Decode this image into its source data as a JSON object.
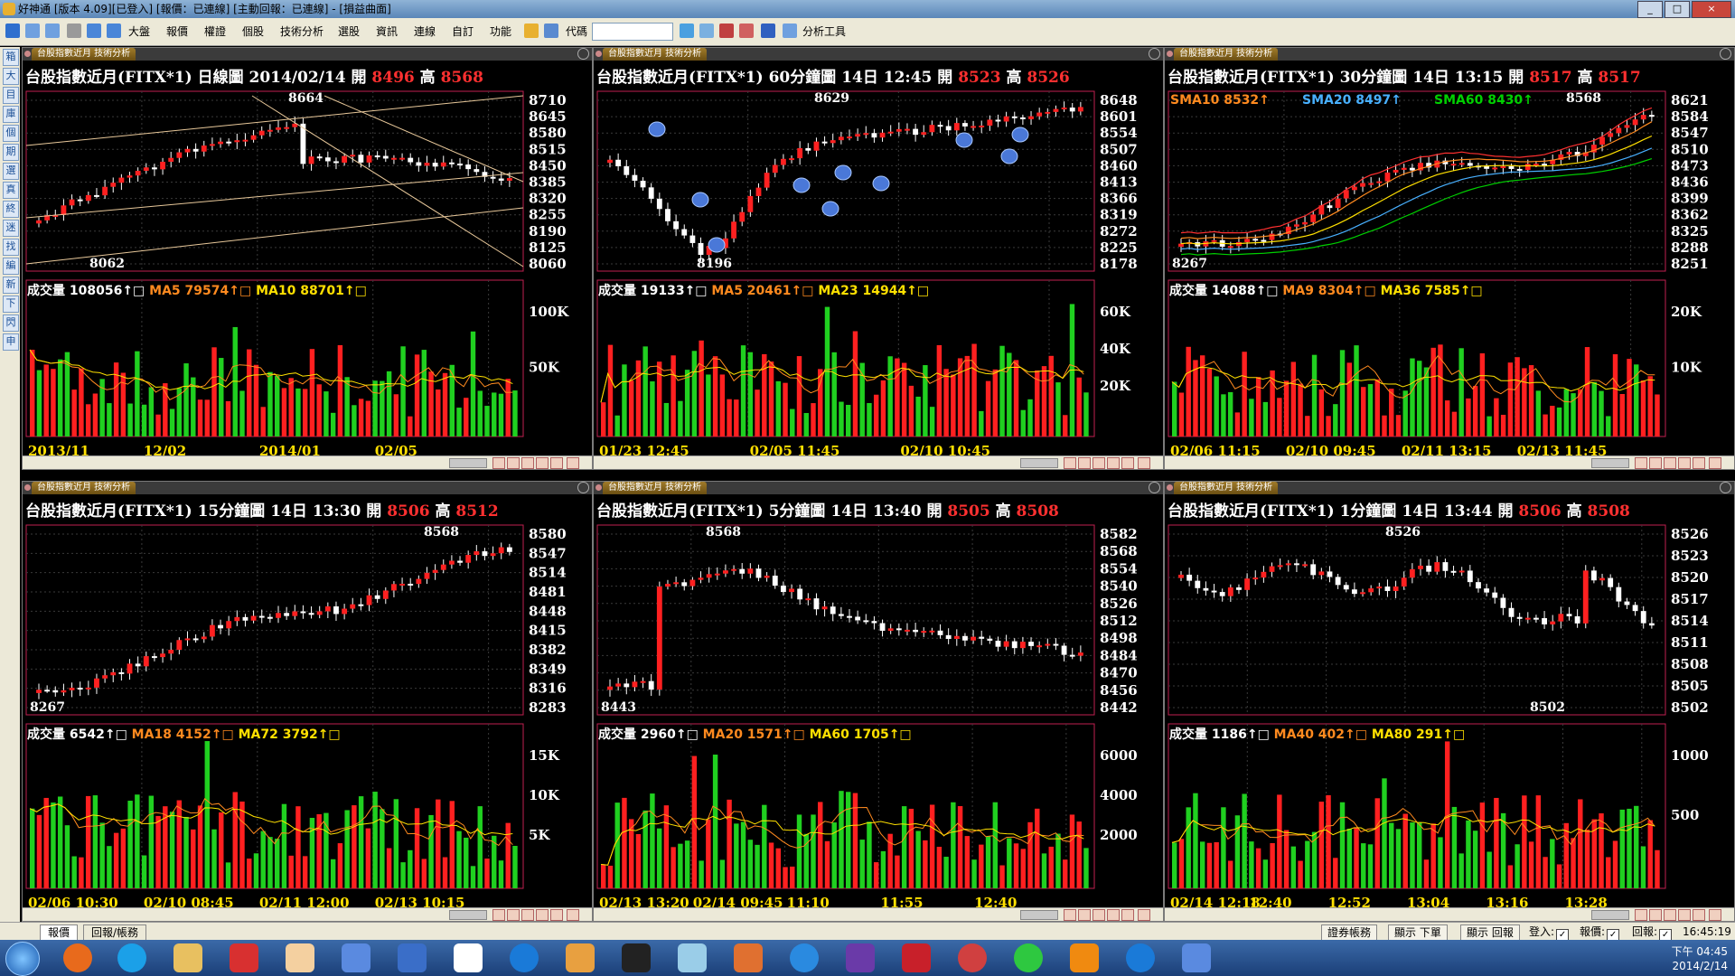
{
  "window": {
    "title": "好神通 [版本 4.09][已登入] [報價：已連線] [主動回報：已連線] - [損益曲面]",
    "buttons": [
      "_",
      "□",
      "×"
    ]
  },
  "toolbar": {
    "menus": [
      "大盤",
      "報價",
      "權證",
      "個股",
      "技術分析",
      "選股",
      "資訊",
      "連線",
      "自訂",
      "功能"
    ],
    "code_label": "代碼",
    "analysis_tool": "分析工具"
  },
  "sidebar": [
    "箱",
    "大",
    "目",
    "庫",
    "個",
    "期",
    "選",
    "真",
    "終",
    "迷",
    "找",
    "編",
    "新",
    "下",
    "閃",
    "申"
  ],
  "colors": {
    "up": "#ff2020",
    "down": "#20d020",
    "grid": "#3a3a3a",
    "axis_text": "#ffffff",
    "ma_orange": "#ff8a1f",
    "ma_yellow": "#ffe000",
    "ma_blue": "#48b0ff",
    "ma_green": "#00d000",
    "ma_red": "#ff3030",
    "trend_line": "#e8c89a"
  },
  "panels": [
    {
      "tab": "台股指數近月 技術分析",
      "symbol": "台股指數近月(FITX*1)",
      "period": "日線圖",
      "time": "2014/02/14",
      "open_label": "開",
      "open": "8496",
      "high_label": "高",
      "high": "8568",
      "price_ticks": [
        "8710",
        "8645",
        "8580",
        "8515",
        "8450",
        "8385",
        "8320",
        "8255",
        "8190",
        "8125",
        "8060"
      ],
      "hi_mark": "8664",
      "lo_mark": "8062",
      "vol_line": {
        "label": "成交量",
        "value": "108056",
        "ma1_label": "MA5",
        "ma1_value": "79574",
        "ma2_label": "MA10",
        "ma2_value": "88701"
      },
      "vol_ticks": [
        "100K",
        "50K"
      ],
      "date_ticks": [
        "2013/11",
        "12/02",
        "2014/01",
        "02/05"
      ]
    },
    {
      "tab": "台股指數近月 技術分析",
      "symbol": "台股指數近月(FITX*1)",
      "period": "60分鐘圖",
      "time": "14日 12:45",
      "open_label": "開",
      "open": "8523",
      "high_label": "高",
      "high": "8526",
      "price_ticks": [
        "8648",
        "8601",
        "8554",
        "8507",
        "8460",
        "8413",
        "8366",
        "8319",
        "8272",
        "8225",
        "8178"
      ],
      "hi_mark": "8629",
      "lo_mark": "8196",
      "vol_line": {
        "label": "成交量",
        "value": "19133",
        "ma1_label": "MA5",
        "ma1_value": "20461",
        "ma2_label": "MA23",
        "ma2_value": "14944"
      },
      "vol_ticks": [
        "60K",
        "40K",
        "20K"
      ],
      "date_ticks": [
        "01/23 12:45",
        "02/05 11:45",
        "02/10 10:45"
      ]
    },
    {
      "tab": "台股指數近月 技術分析",
      "symbol": "台股指數近月(FITX*1)",
      "period": "30分鐘圖",
      "time": "14日 13:15",
      "open_label": "開",
      "open": "8517",
      "high_label": "高",
      "high": "8517",
      "price_ticks": [
        "8621",
        "8584",
        "8547",
        "8510",
        "8473",
        "8436",
        "8399",
        "8362",
        "8325",
        "8288",
        "8251"
      ],
      "hi_mark": "8568",
      "lo_mark": "8267",
      "sma": [
        {
          "label": "SMA10",
          "value": "8532"
        },
        {
          "label": "SMA20",
          "value": "8497"
        },
        {
          "label": "SMA60",
          "value": "8430"
        }
      ],
      "vol_line": {
        "label": "成交量",
        "value": "14088",
        "ma1_label": "MA9",
        "ma1_value": "8304",
        "ma2_label": "MA36",
        "ma2_value": "7585"
      },
      "vol_ticks": [
        "20K",
        "10K"
      ],
      "date_ticks": [
        "02/06 11:15",
        "02/10 09:45",
        "02/11 13:15",
        "02/13 11:45"
      ]
    },
    {
      "tab": "台股指數近月 技術分析",
      "symbol": "台股指數近月(FITX*1)",
      "period": "15分鐘圖",
      "time": "14日 13:30",
      "open_label": "開",
      "open": "8506",
      "high_label": "高",
      "high": "8512",
      "price_ticks": [
        "8580",
        "8547",
        "8514",
        "8481",
        "8448",
        "8415",
        "8382",
        "8349",
        "8316",
        "8283"
      ],
      "hi_mark": "8568",
      "lo_mark": "8267",
      "vol_line": {
        "label": "成交量",
        "value": "6542",
        "ma1_label": "MA18",
        "ma1_value": "4152",
        "ma2_label": "MA72",
        "ma2_value": "3792"
      },
      "vol_ticks": [
        "15K",
        "10K",
        "5K"
      ],
      "date_ticks": [
        "02/06 10:30",
        "02/10 08:45",
        "02/11 12:00",
        "02/13 10:15"
      ]
    },
    {
      "tab": "台股指數近月 技術分析",
      "symbol": "台股指數近月(FITX*1)",
      "period": "5分鐘圖",
      "time": "14日 13:40",
      "open_label": "開",
      "open": "8505",
      "high_label": "高",
      "high": "8508",
      "price_ticks": [
        "8582",
        "8568",
        "8554",
        "8540",
        "8526",
        "8512",
        "8498",
        "8484",
        "8470",
        "8456",
        "8442"
      ],
      "hi_mark": "8568",
      "lo_mark": "8443",
      "vol_line": {
        "label": "成交量",
        "value": "2960",
        "ma1_label": "MA20",
        "ma1_value": "1571",
        "ma2_label": "MA60",
        "ma2_value": "1705"
      },
      "vol_ticks": [
        "6000",
        "4000",
        "2000"
      ],
      "date_ticks": [
        "02/13 13:20",
        "02/14 09:45",
        "11:10",
        "11:55",
        "12:40"
      ]
    },
    {
      "tab": "台股指數近月 技術分析",
      "symbol": "台股指數近月(FITX*1)",
      "period": "1分鐘圖",
      "time": "14日 13:44",
      "open_label": "開",
      "open": "8506",
      "high_label": "高",
      "high": "8508",
      "price_ticks": [
        "8526",
        "8523",
        "8520",
        "8517",
        "8514",
        "8511",
        "8508",
        "8505",
        "8502"
      ],
      "hi_mark": "8526",
      "lo_mark": "8502",
      "vol_line": {
        "label": "成交量",
        "value": "1186",
        "ma1_label": "MA40",
        "ma1_value": "402",
        "ma2_label": "MA80",
        "ma2_value": "291"
      },
      "vol_ticks": [
        "1000",
        "500"
      ],
      "date_ticks": [
        "02/14 12:18",
        "12:40",
        "12:52",
        "13:04",
        "13:16",
        "13:28"
      ]
    }
  ],
  "bottombar": {
    "tabs": [
      "報價",
      "回報/帳務"
    ],
    "buttons": [
      "證券帳務",
      "顯示 下單",
      "顯示 回報"
    ],
    "checks": [
      "登入:",
      "報價:",
      "回報:"
    ],
    "clock": "16:45:19"
  },
  "taskbar": {
    "clock_time": "下午 04:45",
    "clock_date": "2014/2/14"
  }
}
